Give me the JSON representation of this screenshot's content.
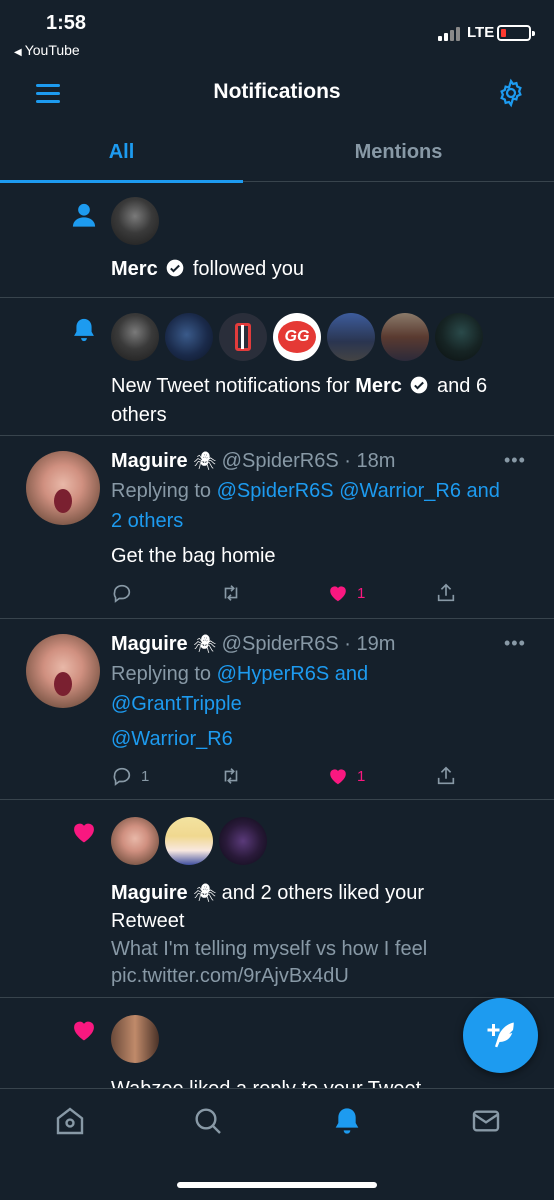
{
  "status_bar": {
    "time": "1:58",
    "back_label": "YouTube",
    "network": "LTE"
  },
  "header": {
    "title": "Notifications",
    "menu_icon": "menu-icon",
    "settings_icon": "gear-icon"
  },
  "tabs": [
    {
      "label": "All",
      "active": true
    },
    {
      "label": "Mentions",
      "active": false
    }
  ],
  "notifications": [
    {
      "type": "follow",
      "icon": "person-icon",
      "name": "Merc",
      "text": "followed you"
    },
    {
      "type": "tweet_notifications",
      "icon": "bell-icon",
      "text_prefix": "New Tweet notifications for",
      "name": "Merc",
      "text_suffix": "and 6",
      "text_line2": "others"
    },
    {
      "type": "reply",
      "name": "Maguire",
      "emoji": "🕷",
      "handle": "@SpiderR6S",
      "time": "· 18m",
      "replying_prefix": "Replying to",
      "replying_users": "@SpiderR6S @Warrior_R6 and",
      "replying_line2": "2 others",
      "body": "Get the bag homie",
      "reply_count": "",
      "retweet_count": "",
      "like_count": "1",
      "liked": true
    },
    {
      "type": "reply",
      "name": "Maguire",
      "emoji": "🕷",
      "handle": "@SpiderR6S",
      "time": "· 19m",
      "replying_prefix": "Replying to",
      "replying_users": "@HyperR6S and",
      "replying_line2": "@GrantTripple",
      "body": "@Warrior_R6",
      "reply_count": "1",
      "retweet_count": "",
      "like_count": "1",
      "liked": true
    },
    {
      "type": "like",
      "icon": "heart-icon",
      "name": "Maguire",
      "emoji": "🕷",
      "text": "and 2 others liked your",
      "text_line2": "Retweet",
      "quote_line1": "What I'm telling myself vs how I feel",
      "quote_line2": "pic.twitter.com/9rAjvBx4dU"
    },
    {
      "type": "like",
      "icon": "heart-icon",
      "partial_text": "Wabzee  liked a reply to your Tweet"
    }
  ],
  "colors": {
    "background": "#15202b",
    "accent": "#1d9bf0",
    "muted": "#8899a6",
    "divider": "#38444d",
    "like": "#f91880"
  },
  "bottom_nav": [
    "home-icon",
    "search-icon",
    "bell-icon",
    "mail-icon"
  ],
  "fab_icon": "compose-tweet-icon"
}
